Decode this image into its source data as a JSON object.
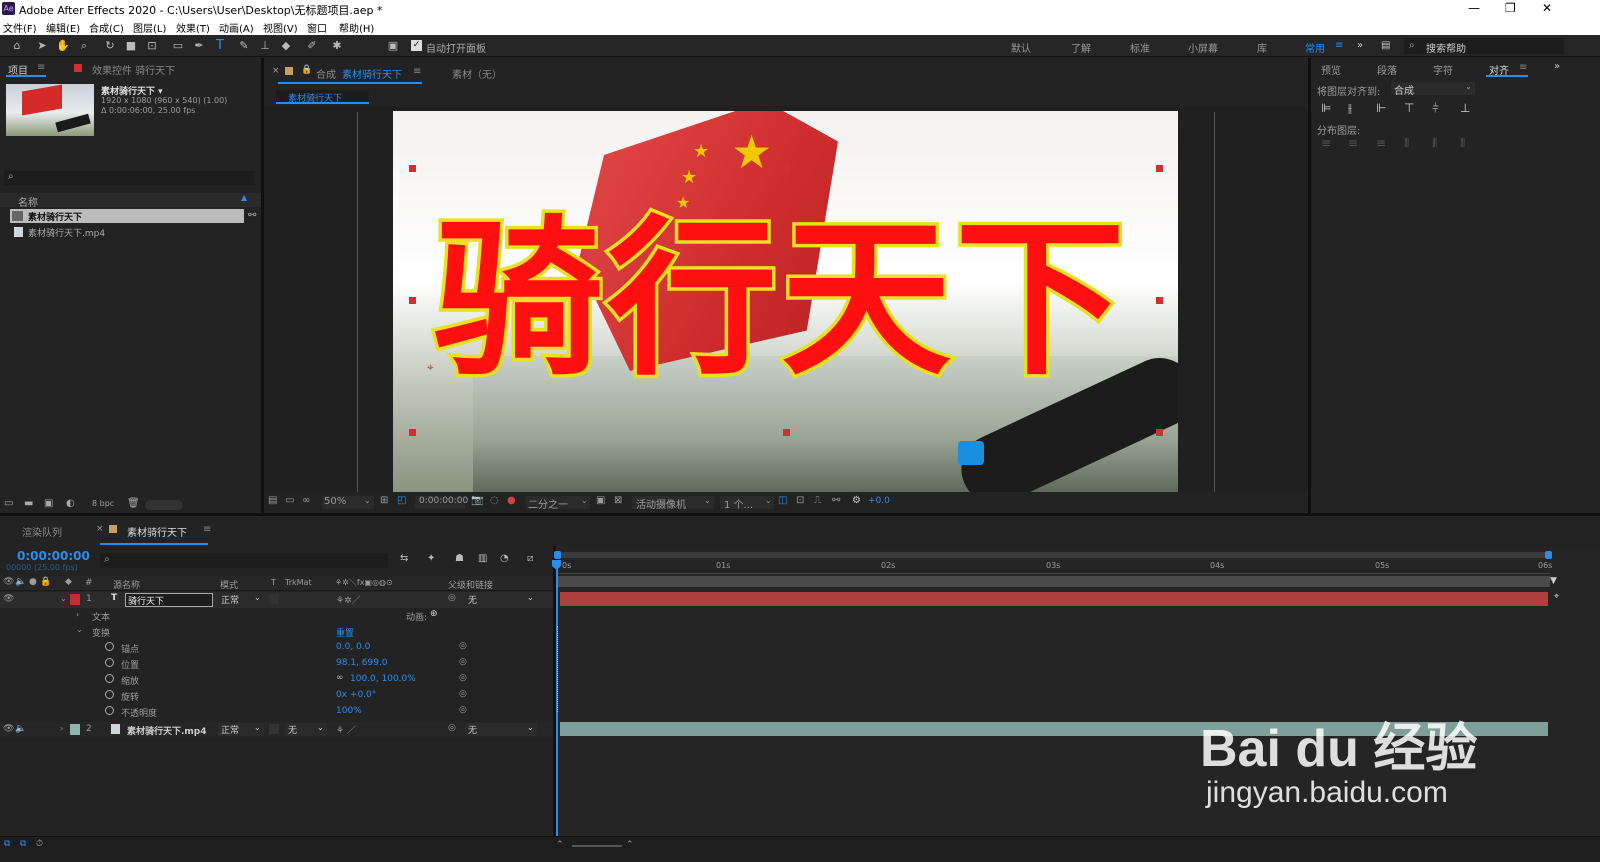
{
  "window": {
    "title": "Adobe After Effects 2020 - C:\\Users\\User\\Desktop\\无标题项目.aep *",
    "app_icon": "Ae",
    "minimize": "—",
    "restore": "❐",
    "close": "✕"
  },
  "menu": [
    "文件(F)",
    "编辑(E)",
    "合成(C)",
    "图层(L)",
    "效果(T)",
    "动画(A)",
    "视图(V)",
    "窗口",
    "帮助(H)"
  ],
  "toolbar": {
    "auto_open_panel": "自动打开面板",
    "workspaces": [
      "默认",
      "了解",
      "标准",
      "小屏幕",
      "库",
      "常用"
    ],
    "active_workspace": "常用",
    "overflow": "»",
    "search_placeholder": "搜索帮助"
  },
  "project_panel": {
    "tab": "项目",
    "effects_tab": "效果控件 骑行天下",
    "item_name": "素材骑行天下 ▾",
    "item_info1": "1920 x 1080  (960 x 540) (1.00)",
    "item_info2": "Δ 0:00:06:00, 25.00 fps",
    "search_placeholder": "",
    "col_name": "名称",
    "items": [
      {
        "name": "素材骑行天下",
        "selected": true
      },
      {
        "name": "素材骑行天下.mp4",
        "selected": false
      }
    ],
    "bpc": "8 bpc"
  },
  "comp_panel": {
    "tab_prefix": "合成",
    "tab_name": "素材骑行天下",
    "footage_tab": "素材（无）",
    "sub_tab": "素材骑行天下"
  },
  "viewer": {
    "title_text": "骑行天下",
    "zoom": "50%",
    "timecode": "0:00:00:00",
    "resolution": "二分之一",
    "camera": "活动摄像机",
    "views": "1 个...",
    "exposure": "+0.0"
  },
  "right_panel": {
    "tabs": [
      "预览",
      "段落",
      "字符",
      "对齐"
    ],
    "active": "对齐",
    "align_to_label": "将图层对齐到:",
    "align_to_value": "合成",
    "distribute_label": "分布图层:"
  },
  "timeline": {
    "render_tab": "渲染队列",
    "comp_tab": "素材骑行天下",
    "timecode": "0:00:00:00",
    "frames": "00000 (25.00 fps)",
    "cols": {
      "num": "#",
      "source": "源名称",
      "mode": "模式",
      "t": "T",
      "trkmat": "TrkMat",
      "parent": "父级和链接"
    },
    "ruler": [
      "0s",
      "01s",
      "02s",
      "03s",
      "04s",
      "05s",
      "06s"
    ],
    "layer1": {
      "num": "1",
      "type": "T",
      "name": "骑行天下",
      "mode": "正常",
      "parent": "无"
    },
    "text_group": "文本",
    "animate": "动画:",
    "transform": "变换",
    "reset": "重置",
    "props": [
      {
        "name": "锚点",
        "value": "0.0, 0.0"
      },
      {
        "name": "位置",
        "value": "98.1, 699.0"
      },
      {
        "name": "缩放",
        "value": "100.0, 100.0%"
      },
      {
        "name": "旋转",
        "value": "0x +0.0°"
      },
      {
        "name": "不透明度",
        "value": "100%"
      }
    ],
    "layer2": {
      "num": "2",
      "name": "素材骑行天下.mp4",
      "mode": "正常",
      "trkmat": "无",
      "parent": "无"
    }
  },
  "watermark": {
    "brand": "Bai du 经验",
    "url": "jingyan.baidu.com"
  },
  "colors": {
    "accent": "#2d8ceb",
    "layer1_bar": "#b0403e",
    "layer2_bar": "#7fa09a",
    "text_fill": "#ff1010",
    "text_stroke": "#e8e020"
  }
}
